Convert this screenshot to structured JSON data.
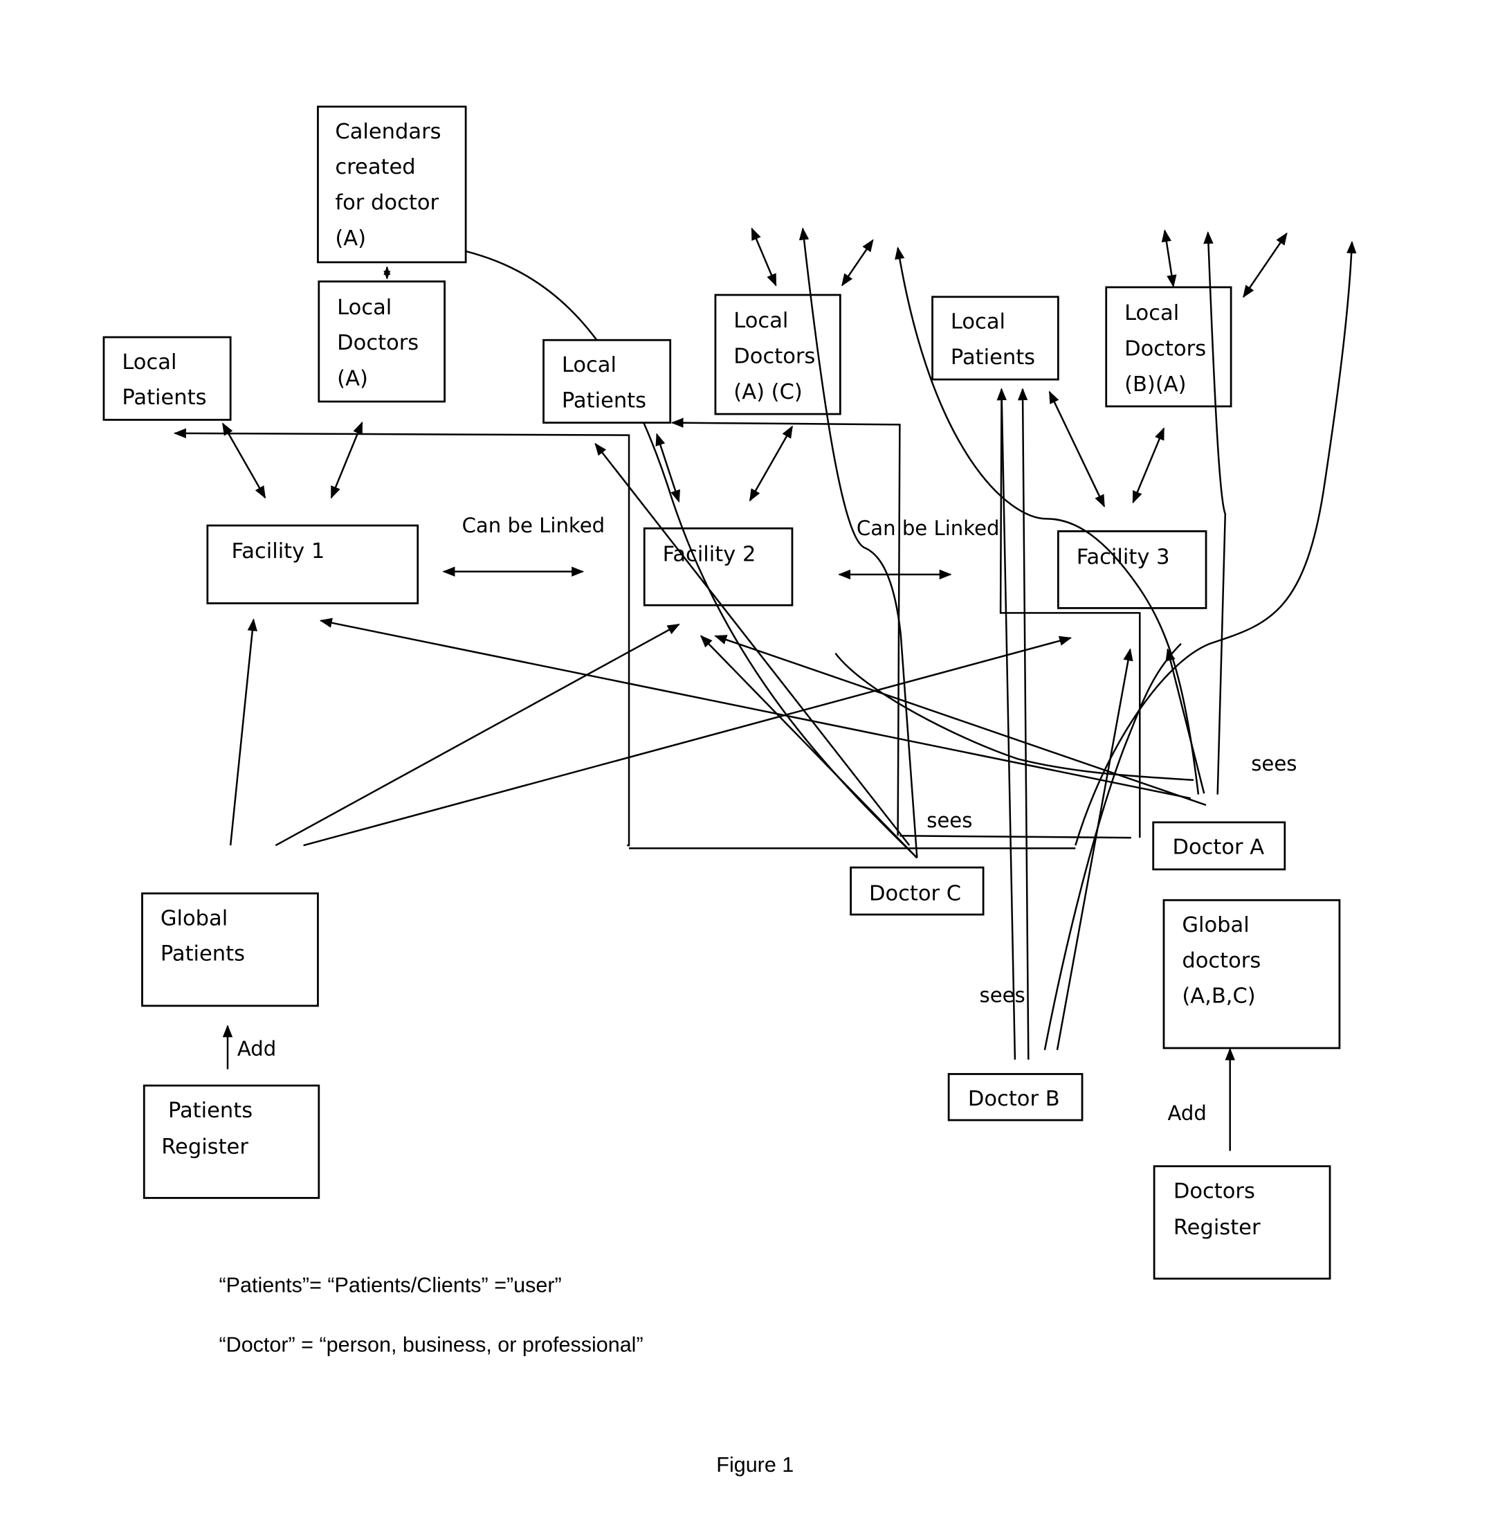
{
  "figure_caption": "Figure 1",
  "boxes": {
    "calendars": {
      "lines": [
        "Calendars",
        "created",
        "for  doctor",
        "(A)"
      ]
    },
    "local_doctors_a": {
      "lines": [
        "Local",
        "Doctors",
        "(A)"
      ]
    },
    "local_patients_1": {
      "lines": [
        "Local",
        "Patients"
      ]
    },
    "local_patients_2": {
      "lines": [
        "Local",
        "Patients"
      ]
    },
    "local_doctors_ac": {
      "lines": [
        "Local",
        "Doctors",
        "(A) (C)"
      ]
    },
    "local_patients_3": {
      "lines": [
        "Local",
        "Patients"
      ]
    },
    "local_doctors_ba": {
      "lines": [
        "Local",
        "Doctors",
        "(B)(A)"
      ]
    },
    "facility_1": {
      "lines": [
        "Facility 1"
      ]
    },
    "facility_2": {
      "lines": [
        "Facility 2"
      ]
    },
    "facility_3": {
      "lines": [
        "Facility 3"
      ]
    },
    "global_patients": {
      "lines": [
        "Global",
        "Patients"
      ]
    },
    "patients_register": {
      "lines": [
        "Patients",
        "Register"
      ]
    },
    "doctor_a": {
      "lines": [
        "Doctor A"
      ]
    },
    "doctor_b": {
      "lines": [
        "Doctor B"
      ]
    },
    "doctor_c": {
      "lines": [
        "Doctor C"
      ]
    },
    "global_doctors": {
      "lines": [
        "Global",
        "doctors",
        "(A,B,C)"
      ]
    },
    "doctors_register": {
      "lines": [
        "Doctors",
        "Register"
      ]
    }
  },
  "edge_labels": {
    "can_be_linked_1": "Can be Linked",
    "can_be_linked_2": "Can be Linked",
    "sees_doctor_c": "sees",
    "sees_doctor_a": "sees",
    "sees_doctor_b": "sees",
    "add_patients": "Add",
    "add_doctors": "Add"
  },
  "notes": [
    "“Patients”= “Patients/Clients” =”user”",
    "“Doctor” = “person, business, or professional”"
  ]
}
